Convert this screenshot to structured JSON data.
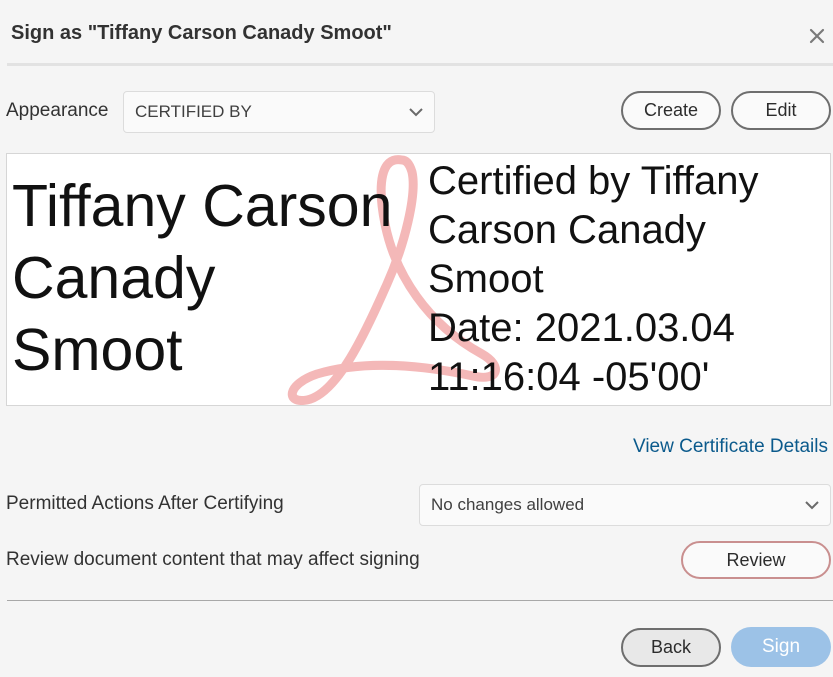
{
  "dialog": {
    "title": "Sign as \"Tiffany Carson Canady Smoot\"",
    "close_icon": "close-icon"
  },
  "appearance": {
    "label": "Appearance",
    "selected": "CERTIFIED BY",
    "create_label": "Create",
    "edit_label": "Edit"
  },
  "preview": {
    "name_lines": [
      "Tiffany Carson",
      "Canady",
      "Smoot"
    ],
    "detail_lines": [
      "Certified by Tiffany",
      "Carson Canady",
      "Smoot",
      "Date: 2021.03.04",
      "11:16:04 -05'00'"
    ],
    "watermark_icon": "adobe-acrobat-logo-icon",
    "watermark_color": "#f4b8b8"
  },
  "certificate_link": "View Certificate Details",
  "permitted": {
    "label": "Permitted Actions After Certifying",
    "selected": "No changes allowed"
  },
  "review": {
    "label": "Review document content that may affect signing",
    "button_label": "Review"
  },
  "footer": {
    "back_label": "Back",
    "sign_label": "Sign"
  }
}
